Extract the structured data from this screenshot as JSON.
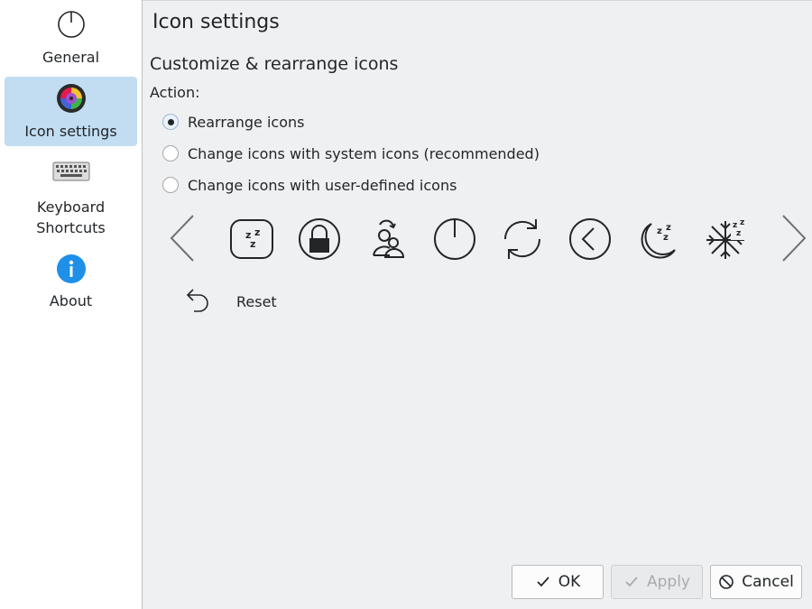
{
  "sidebar": {
    "items": [
      {
        "label": "General",
        "icon": "power-icon",
        "active": false
      },
      {
        "label": "Icon settings",
        "icon": "color-wheel-icon",
        "active": true
      },
      {
        "label": "Keyboard\nShortcuts",
        "icon": "keyboard-icon",
        "active": false
      },
      {
        "label": "About",
        "icon": "info-icon",
        "active": false
      }
    ]
  },
  "main": {
    "title": "Icon settings",
    "section_title": "Customize & rearrange icons",
    "action_label": "Action:",
    "options": [
      {
        "label": "Rearrange icons",
        "checked": true
      },
      {
        "label": "Change icons with system icons (recommended)",
        "checked": false
      },
      {
        "label": "Change icons with user-defined icons",
        "checked": false
      }
    ],
    "icon_strip": [
      "sleep-icon",
      "lock-icon",
      "switch-user-icon",
      "power-icon",
      "reboot-icon",
      "back-icon",
      "moon-sleep-icon",
      "hibernate-icon"
    ],
    "reset_label": "Reset"
  },
  "footer": {
    "ok_label": "OK",
    "apply_label": "Apply",
    "cancel_label": "Cancel"
  },
  "colors": {
    "sidebar_active": "#c2ddf2",
    "info_blue": "#1e90e8",
    "background": "#eff0f1"
  }
}
